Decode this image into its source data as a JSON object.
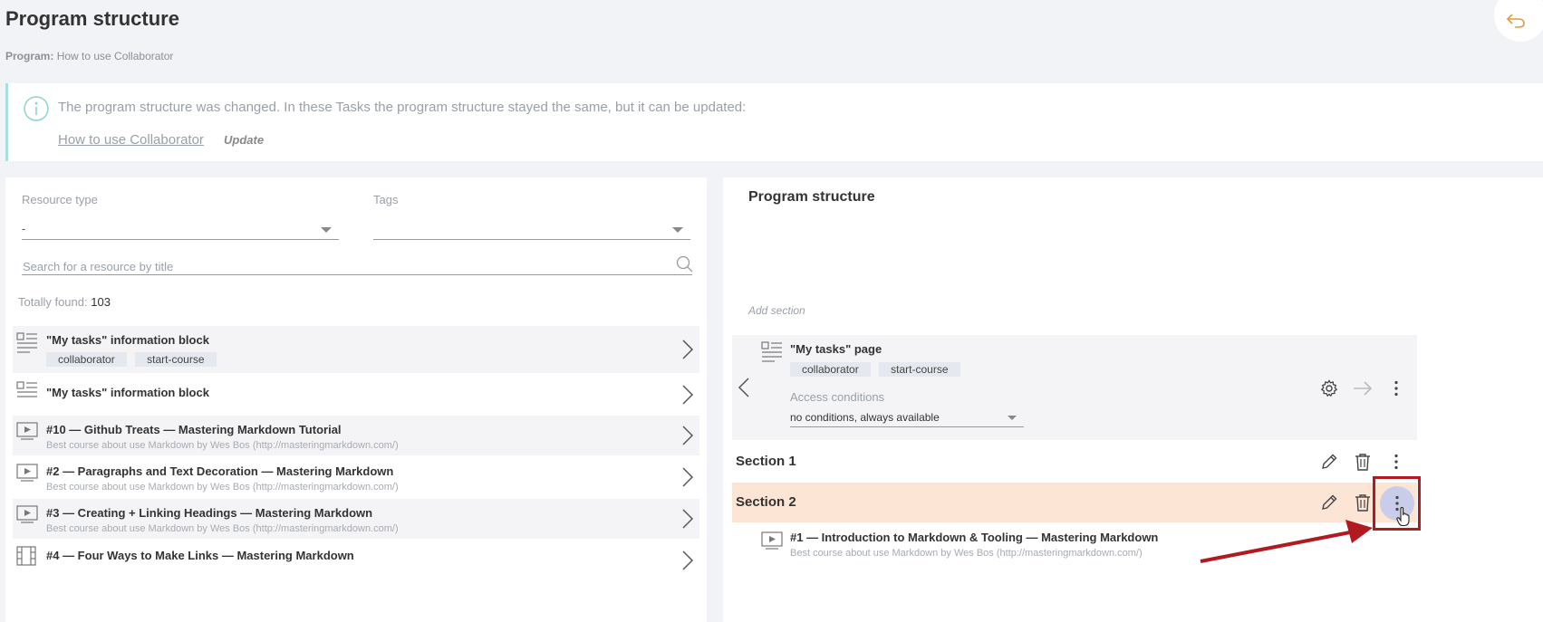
{
  "header": {
    "title": "Program structure",
    "program_label": "Program:",
    "program_name": "How to use Collaborator",
    "back_icon": "undo-arrow-icon"
  },
  "info_bar": {
    "message": "The program structure was changed. In these Tasks the program structure stayed the same, but it can be updated:",
    "task_link": "How to use Collaborator",
    "update_label": "Update"
  },
  "filters": {
    "resource_type_label": "Resource type",
    "resource_type_value": "-",
    "tags_label": "Tags",
    "tags_value": "",
    "search_placeholder": "Search for a resource by title",
    "found_label": "Totally found:",
    "found_count": "103"
  },
  "resources": [
    {
      "icon": "info-block-icon",
      "title": "\"My tasks\" information block",
      "tags": [
        "collaborator",
        "start-course"
      ],
      "desc": ""
    },
    {
      "icon": "info-block-icon",
      "title": "\"My tasks\" information block",
      "tags": [],
      "desc": ""
    },
    {
      "icon": "video-icon",
      "title": "#10 — Github Treats — Mastering Markdown Tutorial",
      "tags": [],
      "desc": "Best course about use Markdown by Wes Bos (http://masteringmarkdown.com/)"
    },
    {
      "icon": "video-icon",
      "title": "#2 — Paragraphs and Text Decoration — Mastering Markdown",
      "tags": [],
      "desc": "Best course about use Markdown by Wes Bos (http://masteringmarkdown.com/)"
    },
    {
      "icon": "video-icon",
      "title": "#3 — Creating + Linking Headings — Mastering Markdown",
      "tags": [],
      "desc": "Best course about use Markdown by Wes Bos (http://masteringmarkdown.com/)"
    },
    {
      "icon": "film-icon",
      "title": "#4 — Four Ways to Make Links — Mastering Markdown",
      "tags": [],
      "desc": ""
    }
  ],
  "structure": {
    "title": "Program structure",
    "add_section": "Add section",
    "page": {
      "title": "\"My tasks\" page",
      "tags": [
        "collaborator",
        "start-course"
      ],
      "access_label": "Access conditions",
      "access_value": "no conditions, always available"
    },
    "sections": [
      {
        "name": "Section 1"
      },
      {
        "name": "Section 2"
      }
    ],
    "section2_item": {
      "title": "#1 — Introduction to Markdown & Tooling — Mastering Markdown",
      "desc": "Best course about use Markdown by Wes Bos (http://masteringmarkdown.com/)"
    }
  },
  "colors": {
    "active_section": "#fde5d5",
    "highlight": "#b11a1f",
    "info_border": "#a9dee0"
  }
}
